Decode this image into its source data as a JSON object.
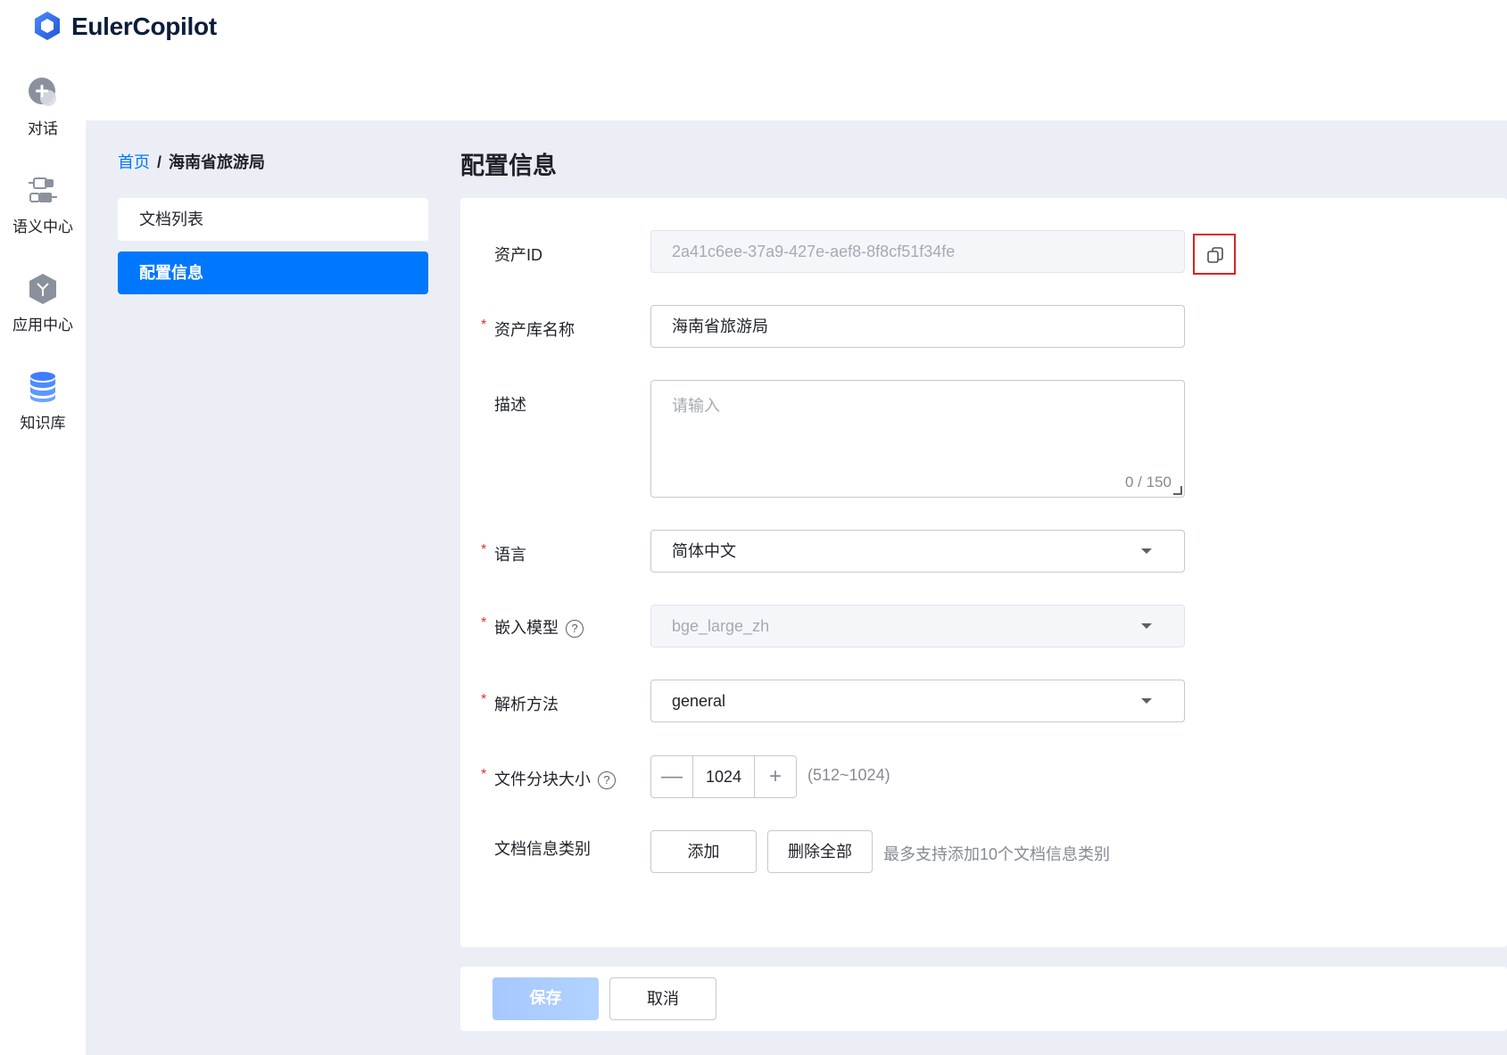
{
  "app": {
    "brand": "EulerCopilot"
  },
  "leftnav": {
    "items": [
      {
        "label": "对话",
        "icon": "chat-plus-icon"
      },
      {
        "label": "语义中心",
        "icon": "plugin-icon"
      },
      {
        "label": "应用中心",
        "icon": "app-cube-icon"
      },
      {
        "label": "知识库",
        "icon": "database-icon"
      }
    ]
  },
  "breadcrumb": {
    "home": "首页",
    "separator": "/",
    "current": "海南省旅游局"
  },
  "side_menu": {
    "items": [
      {
        "label": "文档列表",
        "active": false
      },
      {
        "label": "配置信息",
        "active": true
      }
    ]
  },
  "page": {
    "title": "配置信息"
  },
  "form": {
    "asset_id": {
      "label": "资产ID",
      "value": "2a41c6ee-37a9-427e-aef8-8f8cf51f34fe"
    },
    "asset_name": {
      "label": "资产库名称",
      "value": "海南省旅游局",
      "required": "*"
    },
    "description": {
      "label": "描述",
      "placeholder": "请输入",
      "counter": "0 / 150"
    },
    "language": {
      "label": "语言",
      "value": "简体中文",
      "required": "*"
    },
    "embedding_model": {
      "label": "嵌入模型",
      "value": "bge_large_zh",
      "required": "*",
      "help": "?"
    },
    "parse_method": {
      "label": "解析方法",
      "value": "general",
      "required": "*"
    },
    "chunk_size": {
      "label": "文件分块大小",
      "value": "1024",
      "range_hint": "(512~1024)",
      "required": "*",
      "help": "?",
      "minus": "—",
      "plus": "+"
    },
    "doc_categories": {
      "label": "文档信息类别",
      "add_label": "添加",
      "delete_all_label": "删除全部",
      "hint": "最多支持添加10个文档信息类别"
    }
  },
  "footer": {
    "save_label": "保存",
    "cancel_label": "取消"
  },
  "colors": {
    "accent": "#0077ff",
    "required": "#e02f2f",
    "background": "#ebeff5"
  }
}
